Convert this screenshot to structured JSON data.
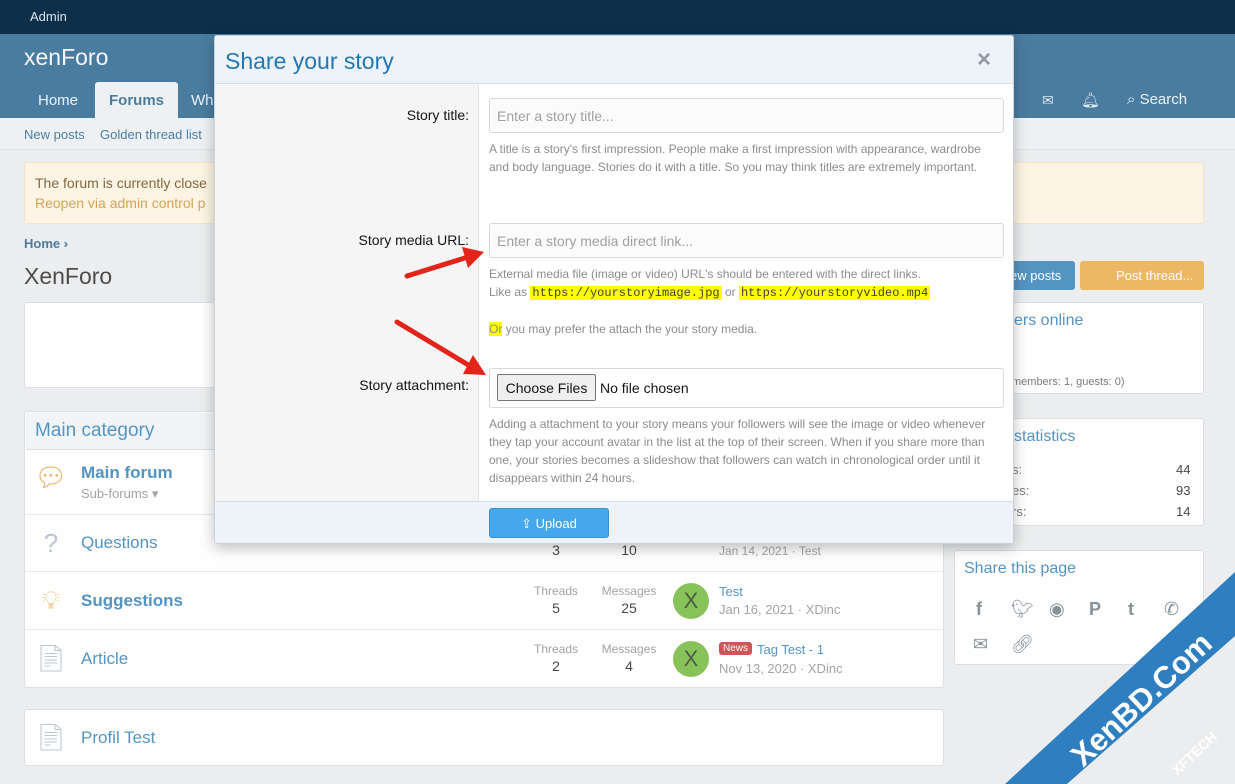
{
  "topbar": {
    "admin": "Admin"
  },
  "header": {
    "logo": "xenForo",
    "tabs": [
      "Home",
      "Forums",
      "Wh"
    ],
    "search": "Search"
  },
  "subnav": {
    "items": [
      "New posts",
      "Golden thread list"
    ]
  },
  "notice": {
    "line1": "The forum is currently close",
    "line2": "Reopen via admin control p"
  },
  "breadcrumb": {
    "home": "Home"
  },
  "page": {
    "title": "XenForo"
  },
  "buttons": {
    "new_posts": "ew posts",
    "post_thread": "Post thread..."
  },
  "category": {
    "title": "Main category"
  },
  "nodes": [
    {
      "title": "Main forum",
      "sub": "Sub-forums",
      "threads": "",
      "messages": "",
      "last_title": "",
      "last_meta": ""
    },
    {
      "title": "Questions",
      "threads": "3",
      "messages": "10",
      "last_title": "",
      "last_meta": "Jan 14, 2021 · Test",
      "avatar": ""
    },
    {
      "title": "Suggestions",
      "threads": "5",
      "messages": "25",
      "last_title": "Test",
      "last_meta": "Jan 16, 2021 · XDinc",
      "avatar": "X"
    },
    {
      "title": "Article",
      "threads": "2",
      "messages": "4",
      "last_title": "Tag Test - 1",
      "badge": "News",
      "last_meta": "Nov 13, 2020 · XDinc",
      "avatar": "X"
    },
    {
      "title": "Profil Test"
    }
  ],
  "stat_labels": {
    "threads": "Threads",
    "messages": "Messages"
  },
  "sidebar": {
    "members_online": "ers online",
    "members_line": "members: 1, guests: 0)",
    "stats_title": "statistics",
    "stats": [
      {
        "label": "s:",
        "value": "44"
      },
      {
        "label": "es:",
        "value": "93"
      },
      {
        "label": "rs:",
        "value": "14"
      }
    ],
    "share_title": "Share this page"
  },
  "modal": {
    "title": "Share your story",
    "close": "×",
    "title_label": "Story title:",
    "title_placeholder": "Enter a story title...",
    "title_hint": "A title is a story's first impression. People make a first impression with appearance, wardrobe and body language. Stories do it with a title. So you may think titles are extremely important.",
    "media_label": "Story media URL:",
    "media_placeholder": "Enter a story media direct link...",
    "media_hint1": "External media file (image or video) URL's should be entered with the direct links.",
    "media_hint2_pre": "Like as",
    "media_url1": "https://yourstoryimage.jpg",
    "media_hint2_or": "or",
    "media_url2": "https://yourstoryvideo.mp4",
    "or_word": "Or",
    "or_rest": "you may prefer the attach the your story media.",
    "attach_label": "Story attachment:",
    "choose_files": "Choose Files",
    "no_file": "No file chosen",
    "attach_hint": "Adding a attachment to your story means your followers will see the image or video whenever they tap your account avatar in the list at the top of their screen. When if you share more than one, your stories becomes a slideshow that followers can watch in chronological order until it disappears within 24 hours.",
    "upload": "Upload"
  },
  "watermark": {
    "line1": "XenBD.Com",
    "line2": "XFTECH"
  }
}
